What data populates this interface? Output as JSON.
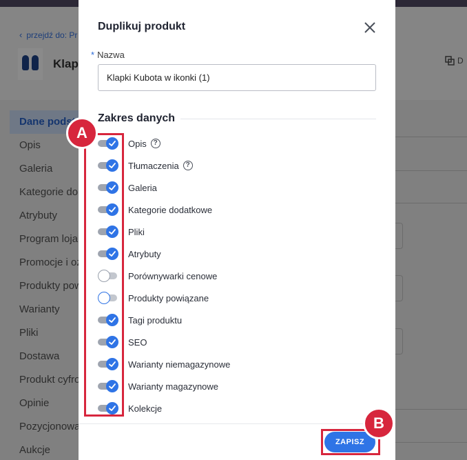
{
  "background": {
    "back_link": "przejdź do: Pr",
    "product_title": "Klapk",
    "duplicate_action": "D",
    "side_menu": [
      {
        "label": "Dane podst",
        "active": true
      },
      {
        "label": "Opis"
      },
      {
        "label": "Galeria"
      },
      {
        "label": "Kategorie do"
      },
      {
        "label": "Atrybuty"
      },
      {
        "label": "Program loja"
      },
      {
        "label": "Promocje i oz"
      },
      {
        "label": "Produkty pow"
      },
      {
        "label": "Warianty"
      },
      {
        "label": "Pliki"
      },
      {
        "label": "Dostawa"
      },
      {
        "label": "Produkt cyfro"
      },
      {
        "label": "Opinie"
      },
      {
        "label": "Pozycjonowa"
      },
      {
        "label": "Aukcje"
      }
    ]
  },
  "modal": {
    "title": "Duplikuj produkt",
    "name_label": "Nazwa",
    "name_value": "Klapki Kubota w ikonki (1)",
    "section_title": "Zakres danych",
    "options": [
      {
        "label": "Opis",
        "checked": true,
        "help": true
      },
      {
        "label": "Tłumaczenia",
        "checked": true,
        "help": true
      },
      {
        "label": "Galeria",
        "checked": true
      },
      {
        "label": "Kategorie dodatkowe",
        "checked": true
      },
      {
        "label": "Pliki",
        "checked": true
      },
      {
        "label": "Atrybuty",
        "checked": true
      },
      {
        "label": "Porównywarki cenowe",
        "checked": false
      },
      {
        "label": "Produkty powiązane",
        "checked": false
      },
      {
        "label": "Tagi produktu",
        "checked": true
      },
      {
        "label": "SEO",
        "checked": true
      },
      {
        "label": "Warianty niemagazynowe",
        "checked": true
      },
      {
        "label": "Warianty magazynowe",
        "checked": true
      },
      {
        "label": "Kolekcje",
        "checked": true
      }
    ],
    "save_label": "ZAPISZ"
  },
  "annotations": {
    "a": "A",
    "b": "B"
  },
  "colors": {
    "accent": "#2f74e6",
    "annotation": "#d7263d"
  }
}
